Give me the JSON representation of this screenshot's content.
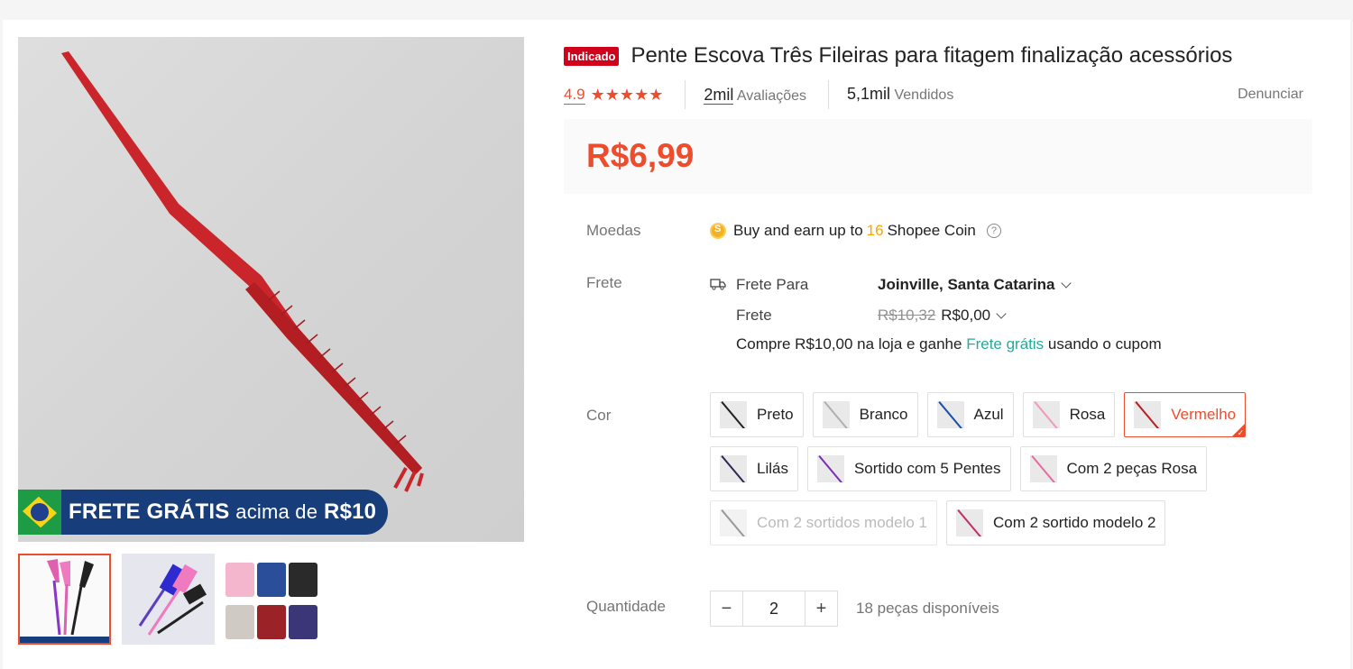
{
  "product": {
    "badge": "Indicado",
    "title": "Pente Escova Três Fileiras para fitagem finalização acessórios",
    "rating": "4.9",
    "stars_filled": 5,
    "reviews_count": "2mil",
    "reviews_label": "Avaliações",
    "sold_count": "5,1mil",
    "sold_label": "Vendidos",
    "report_label": "Denunciar",
    "price": "R$6,99"
  },
  "gallery": {
    "banner_bold": "FRETE GRÁTIS",
    "banner_small": "acima de",
    "banner_value": "R$10",
    "thumb_caption": "FRETE GRÁTIS acima de R$10"
  },
  "coins": {
    "label": "Moedas",
    "text_before": "Buy and earn up to",
    "amount": "16",
    "text_after": "Shopee Coin",
    "help": "?"
  },
  "shipping": {
    "label": "Frete",
    "to_label": "Frete Para",
    "location": "Joinville, Santa Catarina",
    "fee_label": "Frete",
    "old_fee": "R$10,32",
    "fee": "R$0,00",
    "promo_before": "Compre R$10,00 na loja e ganhe",
    "promo_link": "Frete grátis",
    "promo_after": "usando o cupom"
  },
  "color": {
    "label": "Cor",
    "options": [
      {
        "label": "Preto",
        "swatch": "#222222"
      },
      {
        "label": "Branco",
        "swatch": "#b0b0b0"
      },
      {
        "label": "Azul",
        "swatch": "#1c4fa8"
      },
      {
        "label": "Rosa",
        "swatch": "#f29ab8"
      },
      {
        "label": "Vermelho",
        "swatch": "#b91f24"
      },
      {
        "label": "Lilás",
        "swatch": "#2b2a54"
      },
      {
        "label": "Sortido com 5 Pentes",
        "swatch": "#7a2fb8"
      },
      {
        "label": "Com 2 peças Rosa",
        "swatch": "#e86aa2"
      },
      {
        "label": "Com 2 sortidos modelo 1",
        "swatch": "#999999"
      },
      {
        "label": "Com 2 sortido modelo 2",
        "swatch": "#c0306a"
      }
    ],
    "selected": "Vermelho",
    "disabled": "Com 2 sortidos modelo 1"
  },
  "quantity": {
    "label": "Quantidade",
    "minus": "−",
    "value": "2",
    "plus": "+",
    "available": "18 peças disponíveis"
  },
  "colors": {
    "accent": "#ee4d2d",
    "badge": "#d0011b",
    "link_green": "#26aa99",
    "coin": "#f6a700",
    "banner_blue": "#173d7a",
    "comb_red": "#c9252a"
  }
}
